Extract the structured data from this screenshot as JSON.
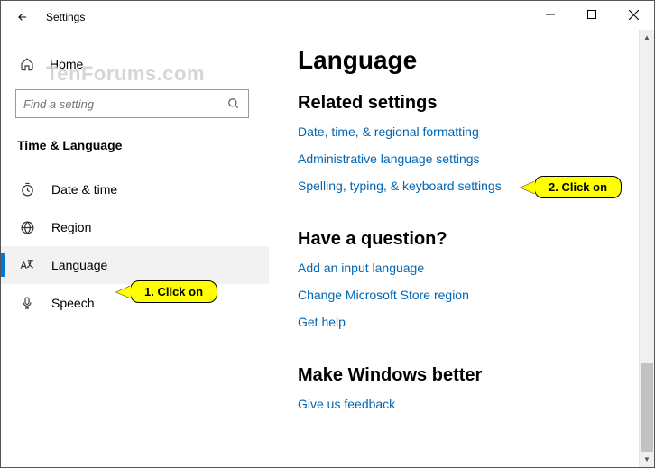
{
  "window": {
    "title": "Settings"
  },
  "sidebar": {
    "home_label": "Home",
    "search_placeholder": "Find a setting",
    "category_title": "Time & Language",
    "items": [
      {
        "label": "Date & time",
        "icon": "clock-icon"
      },
      {
        "label": "Region",
        "icon": "globe-icon"
      },
      {
        "label": "Language",
        "icon": "language-icon",
        "active": true
      },
      {
        "label": "Speech",
        "icon": "mic-icon"
      }
    ]
  },
  "main": {
    "heading": "Language",
    "sections": [
      {
        "title": "Related settings",
        "links": [
          "Date, time, & regional formatting",
          "Administrative language settings",
          "Spelling, typing, & keyboard settings"
        ]
      },
      {
        "title": "Have a question?",
        "links": [
          "Add an input language",
          "Change Microsoft Store region",
          "Get help"
        ]
      },
      {
        "title": "Make Windows better",
        "links": [
          "Give us feedback"
        ]
      }
    ]
  },
  "watermark": "TenForums.com",
  "callouts": {
    "c1": "1. Click on",
    "c2": "2. Click on"
  }
}
